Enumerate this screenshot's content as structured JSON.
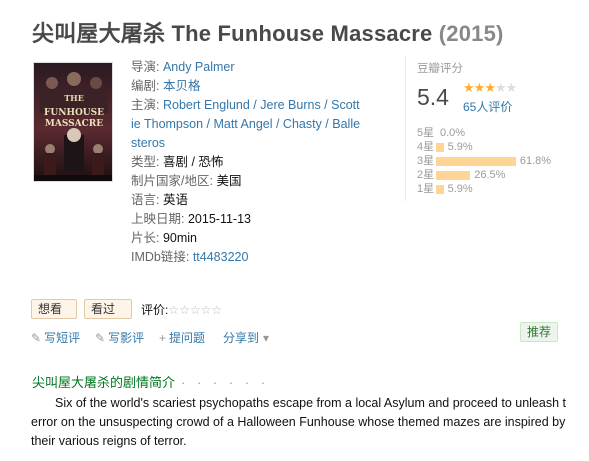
{
  "title": {
    "main": "尖叫屋大屠杀 The Funhouse Massacre",
    "year": "(2015)"
  },
  "poster": {
    "headline": "THE FUNHOUSE MASSACRE",
    "tagline": "NOWHERE TO RUN. NO WAY TO ESCAPE."
  },
  "info": {
    "director_label": "导演:",
    "director": "Andy Palmer",
    "writer_label": "编剧:",
    "writer": "本贝格",
    "cast_label": "主演:",
    "cast_line1": "Robert Englund / Jere Burns / Scott",
    "cast_line2": "ie Thompson / Matt Angel / Chasty / Balle",
    "cast_line3": "steros",
    "genre_label": "类型:",
    "genre": "喜剧 / 恐怖",
    "country_label": "制片国家/地区:",
    "country": "美国",
    "language_label": "语言:",
    "language": "英语",
    "release_label": "上映日期:",
    "release": "2015-11-13",
    "runtime_label": "片长:",
    "runtime": "90min",
    "imdb_label": "IMDb链接:",
    "imdb": "tt4483220"
  },
  "rating": {
    "label": "豆瓣评分",
    "score": "5.4",
    "stars_filled": 3,
    "stars_total": 5,
    "votes": "65人评价",
    "distribution": [
      {
        "label": "5星",
        "pct": "0.0%",
        "value": 0.0
      },
      {
        "label": "4星",
        "pct": "5.9%",
        "value": 5.9
      },
      {
        "label": "3星",
        "pct": "61.8%",
        "value": 61.8
      },
      {
        "label": "2星",
        "pct": "26.5%",
        "value": 26.5
      },
      {
        "label": "1星",
        "pct": "5.9%",
        "value": 5.9
      }
    ]
  },
  "actions": {
    "want": "想看",
    "seen": "看过",
    "my_rating_label": "评价:",
    "empty_stars": "☆☆☆☆☆"
  },
  "links": {
    "short_review": "写短评",
    "review": "写影评",
    "question": "提问题",
    "share": "分享到"
  },
  "recommend": "推荐",
  "synopsis": {
    "title": "尖叫屋大屠杀的剧情简介",
    "dots": "· · · · · ·",
    "line1": "Six of the world's scariest psychopaths escape from a local Asylum and proceed to unleash t",
    "line2": "error on the unsuspecting crowd of a Halloween Funhouse whose themed mazes are inspired by",
    "line3": "their various reigns of terror."
  },
  "colors": {
    "link": "#3377aa",
    "star": "#ffac2d",
    "bar": "#ffd596",
    "green": "#007722"
  }
}
